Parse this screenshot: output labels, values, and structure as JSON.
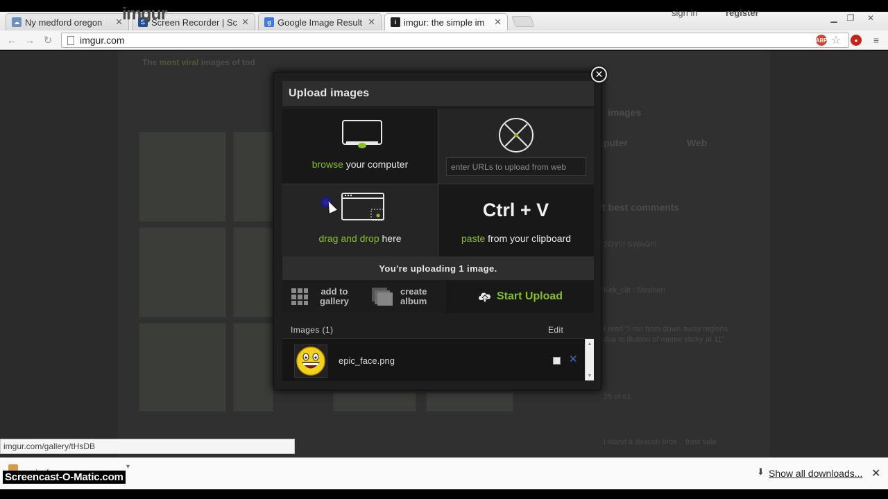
{
  "browser": {
    "tabs": [
      {
        "title": "Ny medford oregon",
        "icon": "weather-icon",
        "active": false
      },
      {
        "title": "Screen Recorder | Sc",
        "icon": "screencast-icon",
        "active": false
      },
      {
        "title": "Google Image Result",
        "icon": "google-icon",
        "active": false
      },
      {
        "title": "imgur: the simple im",
        "icon": "imgur-icon",
        "active": true
      }
    ],
    "url": "imgur.com",
    "status_url": "imgur.com/gallery/tHsDB"
  },
  "page": {
    "logo": "imgur",
    "sign_in": "sign in",
    "register": "register",
    "tagline_prefix": "The ",
    "tagline_highlight": "most viral",
    "tagline_suffix": " images of tod",
    "side_heading_images": "images",
    "side_tab_computer": "puter",
    "side_tab_web": "Web",
    "side_heading_comments": "t best comments",
    "side_comment_1": "2OY!!! SWAG!!!",
    "side_comment_2": "Kek_clit.. Stephen",
    "side_comment_3": "I read \"I ran from down away regions due to illusion of meme sticky at 11\"",
    "side_comment_4": "25 of 61",
    "side_comment_5": "I stand a deacon bros... frost sale"
  },
  "modal": {
    "title": "Upload images",
    "browse_action": "browse",
    "browse_rest": " your computer",
    "url_placeholder": "enter URLs to upload from web",
    "drag_action": "drag and drop",
    "drag_rest": " here",
    "shortcut": "Ctrl + V",
    "paste_action": "paste",
    "paste_rest": " from your clipboard",
    "status": "You're uploading 1 image.",
    "add_gallery_line1": "add to",
    "add_gallery_line2": "gallery",
    "create_album_line1": "create",
    "create_album_line2": "album",
    "start_upload": "Start Upload",
    "images_heading": "Images (1)",
    "edit": "Edit",
    "files": [
      {
        "name": "epic_face.png",
        "checked": false
      }
    ]
  },
  "downloads": {
    "item": "epic_face.png",
    "show_all": "Show all downloads..."
  },
  "watermark": "Screencast-O-Matic.com",
  "colors": {
    "accent_green": "#85bf25",
    "modal_bg": "#1e1e1e",
    "remove_blue": "#3d6ad6"
  }
}
